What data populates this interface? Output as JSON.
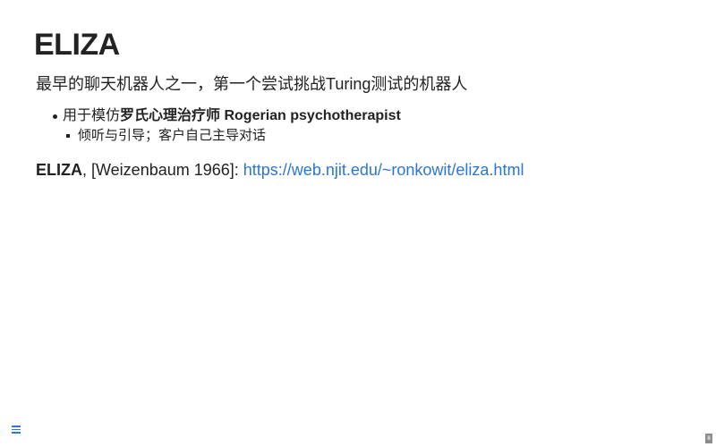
{
  "slide": {
    "title": "ELIZA",
    "subtitle": "最早的聊天机器人之一，第一个尝试挑战Turing测试的机器人",
    "bullets": [
      {
        "prefix": "用于模仿",
        "emphasis": "罗氏心理治疗师 Rogerian psychotherapist",
        "sub_bullets": [
          "倾听与引导；客户自己主导对话"
        ]
      }
    ],
    "reference": {
      "name": "ELIZA",
      "citation": ", [Weizenbaum 1966]: ",
      "url": "https://web.njit.edu/~ronkowit/eliza.html"
    }
  },
  "controls": {
    "menu_icon": "hamburger-menu-icon",
    "page_number": "8"
  },
  "colors": {
    "text": "#222222",
    "link": "#2a76d2",
    "page_badge": "#8d8d8d"
  }
}
